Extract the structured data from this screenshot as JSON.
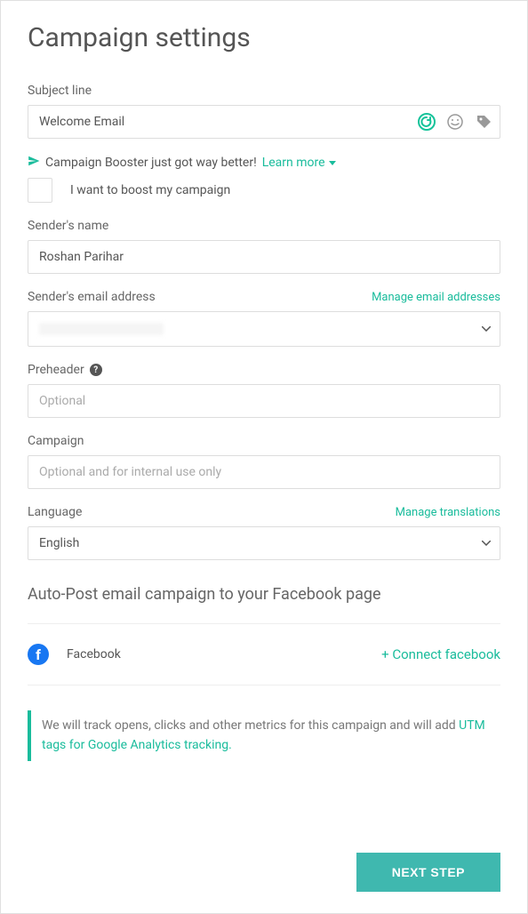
{
  "title": "Campaign settings",
  "subject": {
    "label": "Subject line",
    "value": "Welcome Email"
  },
  "booster": {
    "text": "Campaign Booster just got way better!",
    "learn": "Learn more",
    "checkbox_label": "I want to boost my campaign"
  },
  "sender_name": {
    "label": "Sender's name",
    "value": "Roshan Parihar"
  },
  "sender_email": {
    "label": "Sender's email address",
    "manage": "Manage email addresses"
  },
  "preheader": {
    "label": "Preheader",
    "placeholder": "Optional"
  },
  "campaign": {
    "label": "Campaign",
    "placeholder": "Optional and for internal use only"
  },
  "language": {
    "label": "Language",
    "manage": "Manage translations",
    "value": "English"
  },
  "autopost": {
    "heading": "Auto-Post email campaign to your Facebook page",
    "facebook": "Facebook",
    "connect": "+ Connect facebook"
  },
  "info": {
    "pre": "We will track opens, clicks and other metrics for this campaign and will add ",
    "utm": "UTM tags for Google Analytics tracking."
  },
  "next": "NEXT STEP"
}
